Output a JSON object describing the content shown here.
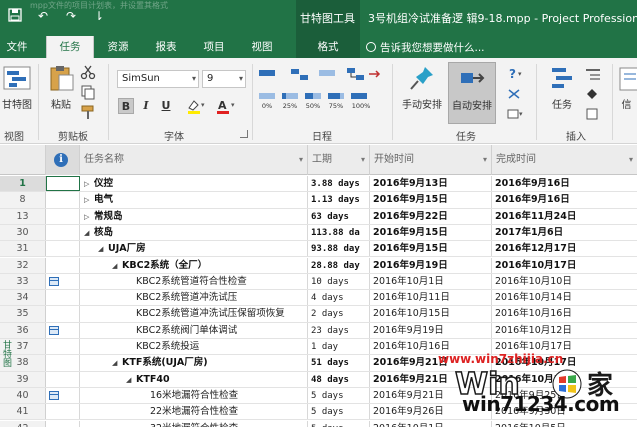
{
  "titlebar": {
    "ghost_text": "mpp文件的项目计划表，并设置其格式",
    "tools_label": "甘特图工具",
    "doc_title": "3号机组冷试准备逻 辑9-18.mpp - Project Professional"
  },
  "tabs": [
    {
      "label": "文件"
    },
    {
      "label": "任务"
    },
    {
      "label": "资源"
    },
    {
      "label": "报表"
    },
    {
      "label": "项目"
    },
    {
      "label": "视图"
    },
    {
      "label": "格式"
    }
  ],
  "tellme": "告诉我您想要做什么...",
  "ribbon": {
    "view": {
      "button": "甘特图",
      "group": "视图"
    },
    "clipboard": {
      "paste": "粘贴",
      "group": "剪贴板"
    },
    "font": {
      "family": "SimSun",
      "size": "9",
      "bold": "B",
      "italic": "I",
      "underline": "U",
      "group": "字体"
    },
    "schedule": {
      "pct": [
        "0%",
        "25%",
        "50%",
        "75%",
        "100%"
      ],
      "group": "日程"
    },
    "tasks": {
      "manual": "手动安排",
      "auto": "自动安排",
      "group": "任务"
    },
    "insert": {
      "task": "任务",
      "group": "插入"
    },
    "info_label": "信"
  },
  "columns": {
    "name": "任务名称",
    "duration": "工期",
    "start": "开始时间",
    "finish": "完成时间"
  },
  "rows": [
    {
      "id": "1",
      "name": "仪控",
      "level": 0,
      "expand": "collapsed",
      "bold": true,
      "icon": false,
      "dur": "3.88 days",
      "start": "2016年9月13日",
      "finish": "2016年9月16日"
    },
    {
      "id": "8",
      "name": "电气",
      "level": 0,
      "expand": "collapsed",
      "bold": true,
      "icon": false,
      "dur": "1.13 days",
      "start": "2016年9月15日",
      "finish": "2016年9月16日"
    },
    {
      "id": "13",
      "name": "常规岛",
      "level": 0,
      "expand": "collapsed",
      "bold": true,
      "icon": false,
      "dur": "63 days",
      "start": "2016年9月22日",
      "finish": "2016年11月24日"
    },
    {
      "id": "30",
      "name": "核岛",
      "level": 0,
      "expand": "expanded",
      "bold": true,
      "icon": false,
      "dur": "113.88 da",
      "start": "2016年9月15日",
      "finish": "2017年1月6日"
    },
    {
      "id": "31",
      "name": "UJA厂房",
      "level": 1,
      "expand": "expanded",
      "bold": true,
      "icon": false,
      "dur": "93.88 day",
      "start": "2016年9月15日",
      "finish": "2016年12月17日"
    },
    {
      "id": "32",
      "name": "KBC2系统（全厂）",
      "level": 2,
      "expand": "expanded",
      "bold": true,
      "icon": false,
      "dur": "28.88 day",
      "start": "2016年9月19日",
      "finish": "2016年10月17日"
    },
    {
      "id": "33",
      "name": "KBC2系统管道符合性检查",
      "level": 3,
      "expand": "none",
      "bold": false,
      "icon": true,
      "dur": "10 days",
      "start": "2016年10月1日",
      "finish": "2016年10月10日"
    },
    {
      "id": "34",
      "name": "KBC2系统管道冲洗试压",
      "level": 3,
      "expand": "none",
      "bold": false,
      "icon": false,
      "dur": "4 days",
      "start": "2016年10月11日",
      "finish": "2016年10月14日"
    },
    {
      "id": "35",
      "name": "KBC2系统管道冲洗试压保留项恢复",
      "level": 3,
      "expand": "none",
      "bold": false,
      "icon": false,
      "dur": "2 days",
      "start": "2016年10月15日",
      "finish": "2016年10月16日"
    },
    {
      "id": "36",
      "name": "KBC2系统阀门单体调试",
      "level": 3,
      "expand": "none",
      "bold": false,
      "icon": true,
      "dur": "23 days",
      "start": "2016年9月19日",
      "finish": "2016年10月12日"
    },
    {
      "id": "37",
      "name": "KBC2系统投运",
      "level": 3,
      "expand": "none",
      "bold": false,
      "icon": false,
      "dur": "1 day",
      "start": "2016年10月16日",
      "finish": "2016年10月17日"
    },
    {
      "id": "38",
      "name": "KTF系统(UJA厂房)",
      "level": 2,
      "expand": "expanded",
      "bold": true,
      "icon": false,
      "dur": "51 days",
      "start": "2016年9月21日",
      "finish": "2016年10月17日"
    },
    {
      "id": "39",
      "name": "KTF40",
      "level": 3,
      "expand": "expanded",
      "bold": true,
      "icon": false,
      "dur": "48 days",
      "start": "2016年9月21日",
      "finish": "2016年10月17日"
    },
    {
      "id": "40",
      "name": "16米地漏符合性检查",
      "level": 4,
      "expand": "none",
      "bold": false,
      "icon": true,
      "dur": "5 days",
      "start": "2016年9月21日",
      "finish": "2016年9月25日"
    },
    {
      "id": "41",
      "name": "22米地漏符合性检查",
      "level": 4,
      "expand": "none",
      "bold": false,
      "icon": false,
      "dur": "5 days",
      "start": "2016年9月26日",
      "finish": "2016年9月30日"
    },
    {
      "id": "42",
      "name": "32米地漏符合性检查",
      "level": 4,
      "expand": "none",
      "bold": false,
      "icon": false,
      "dur": "5 days",
      "start": "2016年10月1日",
      "finish": "2016年10月5日"
    }
  ],
  "side_tab": "甘特图",
  "watermark": {
    "url": "www.win7zhijia.cn",
    "brand": "win71234.com"
  },
  "colors": {
    "accent": "#217346",
    "watermark_red": "#dd2222"
  }
}
